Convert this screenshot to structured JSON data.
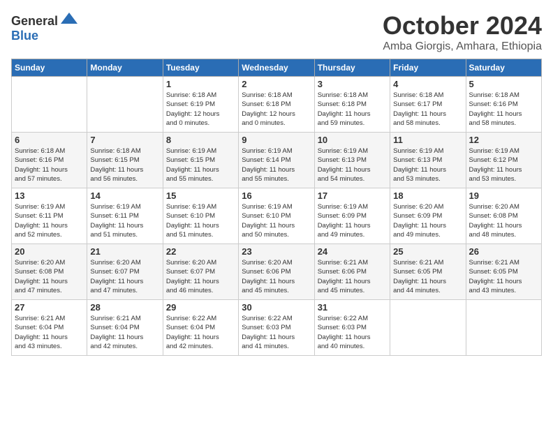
{
  "header": {
    "logo_general": "General",
    "logo_blue": "Blue",
    "month_title": "October 2024",
    "location": "Amba Giorgis, Amhara, Ethiopia"
  },
  "weekdays": [
    "Sunday",
    "Monday",
    "Tuesday",
    "Wednesday",
    "Thursday",
    "Friday",
    "Saturday"
  ],
  "weeks": [
    [
      {
        "day": "",
        "info": ""
      },
      {
        "day": "",
        "info": ""
      },
      {
        "day": "1",
        "info": "Sunrise: 6:18 AM\nSunset: 6:19 PM\nDaylight: 12 hours\nand 0 minutes."
      },
      {
        "day": "2",
        "info": "Sunrise: 6:18 AM\nSunset: 6:18 PM\nDaylight: 12 hours\nand 0 minutes."
      },
      {
        "day": "3",
        "info": "Sunrise: 6:18 AM\nSunset: 6:18 PM\nDaylight: 11 hours\nand 59 minutes."
      },
      {
        "day": "4",
        "info": "Sunrise: 6:18 AM\nSunset: 6:17 PM\nDaylight: 11 hours\nand 58 minutes."
      },
      {
        "day": "5",
        "info": "Sunrise: 6:18 AM\nSunset: 6:16 PM\nDaylight: 11 hours\nand 58 minutes."
      }
    ],
    [
      {
        "day": "6",
        "info": "Sunrise: 6:18 AM\nSunset: 6:16 PM\nDaylight: 11 hours\nand 57 minutes."
      },
      {
        "day": "7",
        "info": "Sunrise: 6:18 AM\nSunset: 6:15 PM\nDaylight: 11 hours\nand 56 minutes."
      },
      {
        "day": "8",
        "info": "Sunrise: 6:19 AM\nSunset: 6:15 PM\nDaylight: 11 hours\nand 55 minutes."
      },
      {
        "day": "9",
        "info": "Sunrise: 6:19 AM\nSunset: 6:14 PM\nDaylight: 11 hours\nand 55 minutes."
      },
      {
        "day": "10",
        "info": "Sunrise: 6:19 AM\nSunset: 6:13 PM\nDaylight: 11 hours\nand 54 minutes."
      },
      {
        "day": "11",
        "info": "Sunrise: 6:19 AM\nSunset: 6:13 PM\nDaylight: 11 hours\nand 53 minutes."
      },
      {
        "day": "12",
        "info": "Sunrise: 6:19 AM\nSunset: 6:12 PM\nDaylight: 11 hours\nand 53 minutes."
      }
    ],
    [
      {
        "day": "13",
        "info": "Sunrise: 6:19 AM\nSunset: 6:11 PM\nDaylight: 11 hours\nand 52 minutes."
      },
      {
        "day": "14",
        "info": "Sunrise: 6:19 AM\nSunset: 6:11 PM\nDaylight: 11 hours\nand 51 minutes."
      },
      {
        "day": "15",
        "info": "Sunrise: 6:19 AM\nSunset: 6:10 PM\nDaylight: 11 hours\nand 51 minutes."
      },
      {
        "day": "16",
        "info": "Sunrise: 6:19 AM\nSunset: 6:10 PM\nDaylight: 11 hours\nand 50 minutes."
      },
      {
        "day": "17",
        "info": "Sunrise: 6:19 AM\nSunset: 6:09 PM\nDaylight: 11 hours\nand 49 minutes."
      },
      {
        "day": "18",
        "info": "Sunrise: 6:20 AM\nSunset: 6:09 PM\nDaylight: 11 hours\nand 49 minutes."
      },
      {
        "day": "19",
        "info": "Sunrise: 6:20 AM\nSunset: 6:08 PM\nDaylight: 11 hours\nand 48 minutes."
      }
    ],
    [
      {
        "day": "20",
        "info": "Sunrise: 6:20 AM\nSunset: 6:08 PM\nDaylight: 11 hours\nand 47 minutes."
      },
      {
        "day": "21",
        "info": "Sunrise: 6:20 AM\nSunset: 6:07 PM\nDaylight: 11 hours\nand 47 minutes."
      },
      {
        "day": "22",
        "info": "Sunrise: 6:20 AM\nSunset: 6:07 PM\nDaylight: 11 hours\nand 46 minutes."
      },
      {
        "day": "23",
        "info": "Sunrise: 6:20 AM\nSunset: 6:06 PM\nDaylight: 11 hours\nand 45 minutes."
      },
      {
        "day": "24",
        "info": "Sunrise: 6:21 AM\nSunset: 6:06 PM\nDaylight: 11 hours\nand 45 minutes."
      },
      {
        "day": "25",
        "info": "Sunrise: 6:21 AM\nSunset: 6:05 PM\nDaylight: 11 hours\nand 44 minutes."
      },
      {
        "day": "26",
        "info": "Sunrise: 6:21 AM\nSunset: 6:05 PM\nDaylight: 11 hours\nand 43 minutes."
      }
    ],
    [
      {
        "day": "27",
        "info": "Sunrise: 6:21 AM\nSunset: 6:04 PM\nDaylight: 11 hours\nand 43 minutes."
      },
      {
        "day": "28",
        "info": "Sunrise: 6:21 AM\nSunset: 6:04 PM\nDaylight: 11 hours\nand 42 minutes."
      },
      {
        "day": "29",
        "info": "Sunrise: 6:22 AM\nSunset: 6:04 PM\nDaylight: 11 hours\nand 42 minutes."
      },
      {
        "day": "30",
        "info": "Sunrise: 6:22 AM\nSunset: 6:03 PM\nDaylight: 11 hours\nand 41 minutes."
      },
      {
        "day": "31",
        "info": "Sunrise: 6:22 AM\nSunset: 6:03 PM\nDaylight: 11 hours\nand 40 minutes."
      },
      {
        "day": "",
        "info": ""
      },
      {
        "day": "",
        "info": ""
      }
    ]
  ]
}
